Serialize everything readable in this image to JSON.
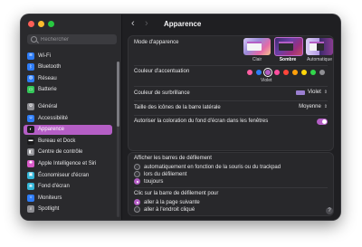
{
  "window": {
    "title": "Apparence"
  },
  "search": {
    "placeholder": "Rechercher"
  },
  "sidebar": {
    "items": [
      {
        "label": "Wi-Fi",
        "icon": "wifi-icon",
        "color": "#2e7cf6",
        "glyph": "≋"
      },
      {
        "label": "Bluetooth",
        "icon": "bluetooth-icon",
        "color": "#2e7cf6",
        "glyph": "ᛒ"
      },
      {
        "label": "Réseau",
        "icon": "network-icon",
        "color": "#2e7cf6",
        "glyph": "◍"
      },
      {
        "label": "Batterie",
        "icon": "battery-icon",
        "color": "#34c759",
        "glyph": "▭"
      },
      {
        "label": "Général",
        "icon": "gear-icon",
        "color": "#8e8e93",
        "glyph": "⚙"
      },
      {
        "label": "Accessibilité",
        "icon": "accessibility-icon",
        "color": "#2e7cf6",
        "glyph": "☺"
      },
      {
        "label": "Apparence",
        "icon": "appearance-icon",
        "color": "#1c1c1e",
        "glyph": "◐"
      },
      {
        "label": "Bureau et Dock",
        "icon": "dock-icon",
        "color": "#1c1c1e",
        "glyph": "▬"
      },
      {
        "label": "Centre de contrôle",
        "icon": "control-center-icon",
        "color": "#8e8e93",
        "glyph": "◧"
      },
      {
        "label": "Apple Intelligence et Siri",
        "icon": "siri-icon",
        "color": "#d85ac8",
        "glyph": "✺"
      },
      {
        "label": "Économiseur d'écran",
        "icon": "screensaver-icon",
        "color": "#35b6d8",
        "glyph": "▣"
      },
      {
        "label": "Fond d'écran",
        "icon": "wallpaper-icon",
        "color": "#35b6d8",
        "glyph": "❀"
      },
      {
        "label": "Moniteurs",
        "icon": "display-icon",
        "color": "#2e7cf6",
        "glyph": "☼"
      },
      {
        "label": "Spotlight",
        "icon": "spotlight-icon",
        "color": "#8e8e93",
        "glyph": "⌕"
      }
    ],
    "active_index": 6
  },
  "appearance": {
    "mode_label": "Mode d'apparence",
    "modes": [
      {
        "label": "Clair",
        "icon": "light-mode-thumbnail"
      },
      {
        "label": "Sombre",
        "icon": "dark-mode-thumbnail"
      },
      {
        "label": "Automatique",
        "icon": "auto-mode-thumbnail"
      }
    ],
    "selected_mode": "Sombre",
    "accent_label": "Couleur d'accentuation",
    "accent_colors": [
      "#ff5fa2",
      "#2e7cf6",
      "#b45ec5",
      "#ff4fa0",
      "#ff453a",
      "#ff9f0a",
      "#ffd60a",
      "#32d74b",
      "#8e8e93"
    ],
    "accent_selected_caption": "Violet",
    "highlight_label": "Couleur de surbrillance",
    "highlight_value": "Violet",
    "highlight_color": "#9b7fd1",
    "sidebar_icon_label": "Taille des icônes de la barre latérale",
    "sidebar_icon_value": "Moyenne",
    "tint_label": "Autoriser la coloration du fond d'écran dans les fenêtres",
    "tint_on": true
  },
  "scrollbars": {
    "show_label": "Afficher les barres de défilement",
    "show_options": [
      "automatiquement en fonction de la souris ou du trackpad",
      "lors du défilement",
      "toujours"
    ],
    "show_selected": 2,
    "click_label": "Clic sur la barre de défilement pour",
    "click_options": [
      "aller à la page suivante",
      "aller à l'endroit cliqué"
    ],
    "click_selected": 0
  },
  "help": {
    "label": "?"
  }
}
